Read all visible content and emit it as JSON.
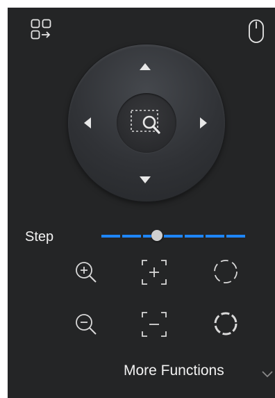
{
  "toolbar": {
    "layout_icon": "grid-arrow-icon",
    "mouse_icon": "mouse-icon"
  },
  "ptz": {
    "up_icon": "arrow-up-icon",
    "down_icon": "arrow-down-icon",
    "left_icon": "arrow-left-icon",
    "right_icon": "arrow-right-icon",
    "center_icon": "region-zoom-icon"
  },
  "step": {
    "label": "Step",
    "value_fraction": 0.38,
    "color": "#1e86ff"
  },
  "functions": [
    {
      "name": "zoom-in",
      "icon": "zoom-in-icon"
    },
    {
      "name": "focus-plus",
      "icon": "focus-plus-icon"
    },
    {
      "name": "iris-plus",
      "icon": "iris-open-icon"
    },
    {
      "name": "zoom-out",
      "icon": "zoom-out-icon"
    },
    {
      "name": "focus-minus",
      "icon": "focus-minus-icon"
    },
    {
      "name": "iris-minus",
      "icon": "iris-close-icon"
    }
  ],
  "more": {
    "label": "More Functions",
    "icon": "chevron-down-icon"
  }
}
